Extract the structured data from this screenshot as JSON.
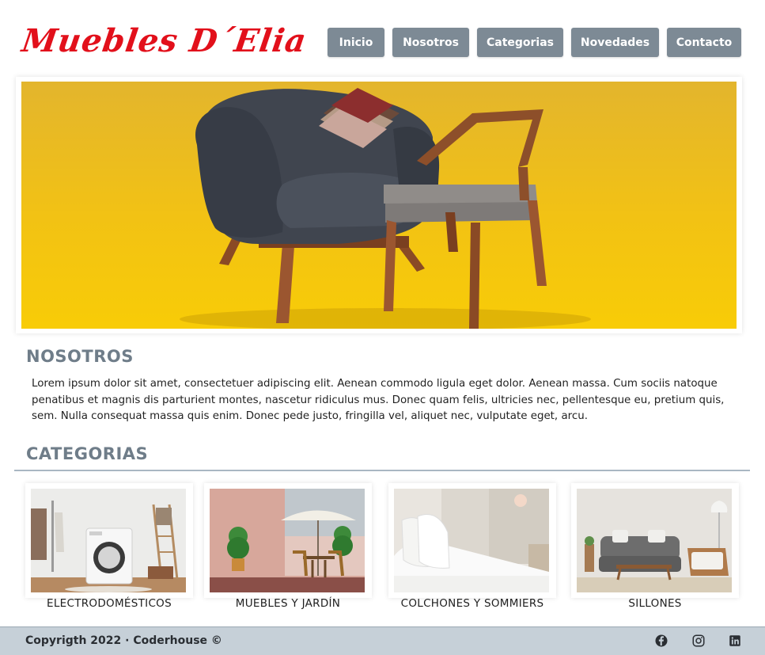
{
  "brand": {
    "logo_text": "Muebles D´Elia",
    "color": "#e2101b"
  },
  "nav": {
    "items": [
      {
        "label": "Inicio"
      },
      {
        "label": "Nosotros"
      },
      {
        "label": "Categorias"
      },
      {
        "label": "Novedades"
      },
      {
        "label": "Contacto"
      }
    ],
    "button_color": "#7d8a95"
  },
  "about": {
    "title": "NOSOTROS",
    "text": "Lorem ipsum dolor sit amet, consectetuer adipiscing elit. Aenean commodo  ligula eget dolor. Aenean massa. Cum sociis natoque penatibus et magnis  dis parturient montes, nascetur ridiculus mus. Donec quam felis,  ultricies nec, pellentesque eu, pretium quis, sem. Nulla consequat massa  quis enim. Donec pede justo, fringilla vel, aliquet nec, vulputate  eget, arcu."
  },
  "categories": {
    "title": "CATEGORIAS",
    "items": [
      {
        "label": "ELECTRODOMÉSTICOS"
      },
      {
        "label": "MUEBLES Y JARDÍN"
      },
      {
        "label": "COLCHONES Y SOMMIERS"
      },
      {
        "label": "SILLONES"
      }
    ]
  },
  "footer": {
    "copyright": "Copyrigth 2022 · Coderhouse ©",
    "social": [
      "facebook-icon",
      "instagram-icon",
      "linkedin-icon"
    ],
    "background": "#c6d0d8"
  },
  "hero": {
    "background": "#f2c214"
  }
}
